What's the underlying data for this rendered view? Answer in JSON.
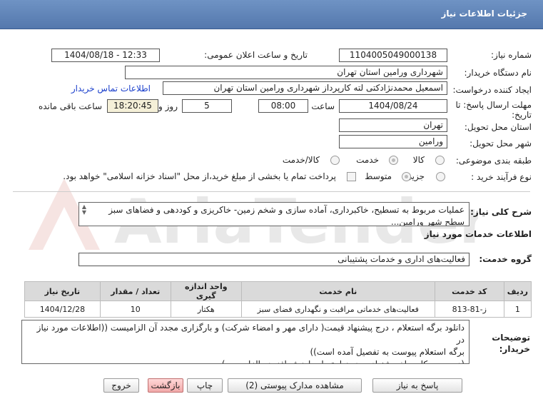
{
  "header": {
    "title": "جزئیات اطلاعات نیاز"
  },
  "form": {
    "need_number_label": "شماره نیاز:",
    "need_number": "1104005049000138",
    "announce_label": "تاریخ و ساعت اعلان عمومی:",
    "announce_value": "1404/08/18 - 12:33",
    "buyer_label": "نام دستگاه خریدار:",
    "buyer_value": "شهرداری ورامین استان تهران",
    "creator_label": "ایجاد کننده درخواست:",
    "creator_value": "اسمعیل محمدنژادکتی لته کارپرداز شهرداری ورامین استان تهران",
    "contact_link": "اطلاعات تماس خریدار",
    "deadline_label_1": "مهلت ارسال پاسخ: تا",
    "deadline_label_2": "تاریخ:",
    "deadline_date": "1404/08/24",
    "time_label": "ساعت",
    "deadline_time": "08:00",
    "days_value": "5",
    "days_label": "روز و",
    "remaining_time": "18:20:45",
    "remaining_label": "ساعت باقی مانده",
    "province_label": "استان محل تحویل:",
    "province_value": "تهران",
    "city_label": "شهر محل تحویل:",
    "city_value": "ورامین",
    "category_label": "طبقه بندی موضوعی:",
    "category_options": [
      "کالا",
      "خدمت",
      "کالا/خدمت"
    ],
    "process_label": "نوع فرآیند خرید :",
    "process_options": [
      "جزیی",
      "متوسط"
    ],
    "payment_note": "پرداخت تمام یا بخشی از مبلغ خرید،از محل \"اسناد خزانه اسلامی\" خواهد بود."
  },
  "summary": {
    "label": "شرح کلی نیاز:",
    "text": "عملیات مربوط به تسطیح، خاکبرداری، آماده سازی و شخم زمین- خاکریزی و کوددهی و فضاهای سبز سطح شهر ورامین..."
  },
  "services": {
    "section_title": "اطلاعات خدمات مورد نیاز",
    "group_label": "گروه خدمت:",
    "group_value": "فعالیت‌های اداری و خدمات پشتیبانی",
    "columns": [
      "ردیف",
      "کد خدمت",
      "نام خدمت",
      "واحد اندازه گیری",
      "تعداد / مقدار",
      "تاریخ نیاز"
    ],
    "rows": [
      [
        "1",
        "ز-81-813",
        "فعالیت‌های خدماتی مراقبت و نگهداری فضای سبز",
        "هکتار",
        "10",
        "1404/12/28"
      ]
    ]
  },
  "notes": {
    "label_1": "توضیحات",
    "label_2": "خریدار:",
    "lines": [
      "دانلود برگه استعلام ، درج پیشنهاد قیمت( دارای مهر و امضاء شرکت) و بارگزاری مجدد آن الزامیست ((اطلاعات مورد نیاز در",
      "برگه استعلام پیوست به تفصیل آمده است))",
      "(درج  جمع کل مبلغ پیشنهادی بدون احتساب ارزش افزوده الزامیست)"
    ]
  },
  "buttons": {
    "reply": "پاسخ به نیاز",
    "view_docs": "مشاهده مدارک پیوستی (2)",
    "print": "چاپ",
    "back": "بازگشت",
    "exit": "خروج"
  },
  "watermark": {
    "text": "AriaTender.net"
  },
  "colors": {
    "header": "#5f83b8",
    "link": "#1a3fcc",
    "exit_button": "#f1a9a9"
  }
}
